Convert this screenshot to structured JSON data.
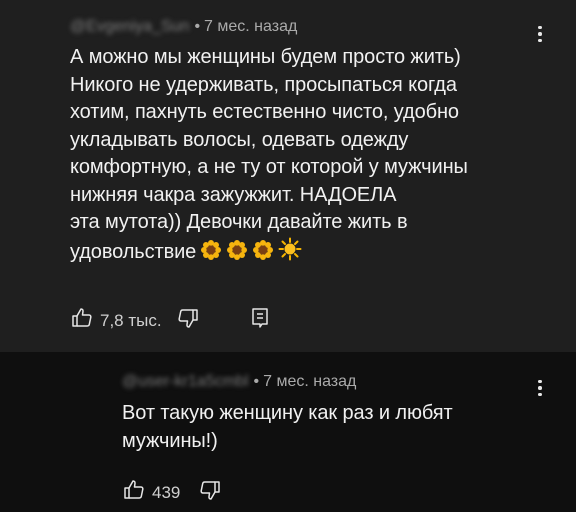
{
  "comments": [
    {
      "author": "@Evgeniya_Sun",
      "time": "7 мес. назад",
      "text": "А можно мы женщины будем просто жить)\nНикого не удерживать, просыпаться когда\nхотим, пахнуть естественно чисто, удобно\nукладывать волосы, одевать одежду\nкомфортную, а не ту от которой у мужчины\nнижняя чакра зажужжит. НАДОЕЛА\nэта мутота)) Девочки давайте жить в\nудовольствие",
      "emojis": [
        "sunflower-icon",
        "sunflower-icon",
        "sunflower-icon",
        "sun-icon"
      ],
      "likes": "7,8 тыс."
    },
    {
      "author": "@user-kr1a5cmbl",
      "time": "7 мес. назад",
      "text": "Вот такую женщину как раз и любят\nмужчины!)",
      "likes": "439"
    }
  ],
  "colors": {
    "background": "#1f1f1f",
    "reply_background": "#0f0f0f",
    "text": "#f1f1f1",
    "meta": "#aaaaaa"
  }
}
